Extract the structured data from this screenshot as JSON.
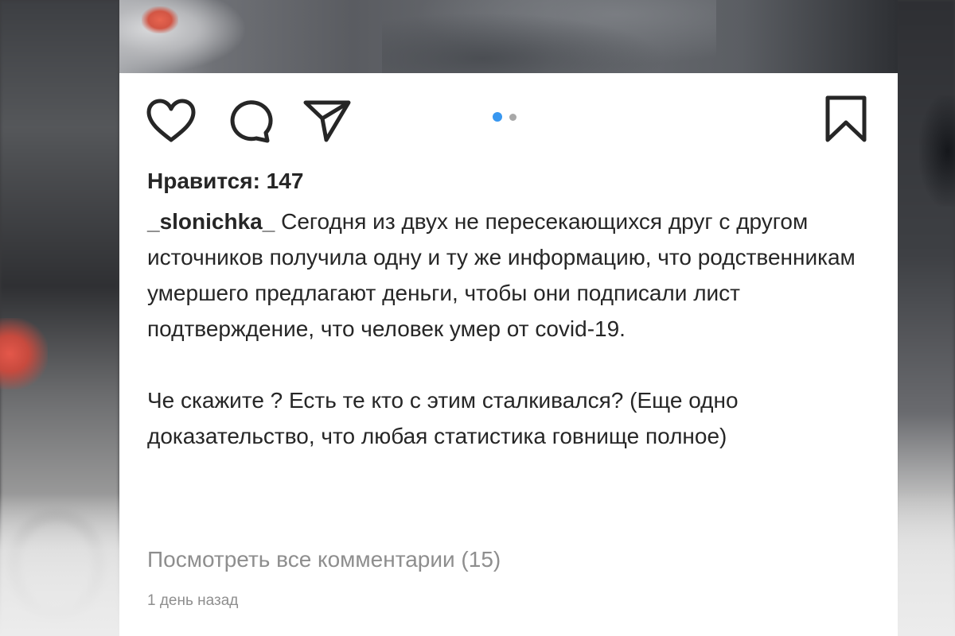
{
  "post": {
    "likes_text": "Нравится: 147",
    "author": "_slonichka_",
    "caption_paragraph_1": "Сегодня из двух не пересекающихся друг с другом источников получила одну и ту же информацию, что родственникам умершего предлагают деньги, чтобы они подписали лист подтверждение, что человек умер от covid-19.",
    "caption_paragraph_2": "Че скажите ? Есть те кто с этим сталкивался? (Еще одно доказательство, что любая статистика говнище полное)",
    "view_comments": "Посмотреть все комментарии (15)",
    "timestamp": "1 день назад"
  },
  "actions": {
    "icons": [
      "heart-icon",
      "comment-icon",
      "share-icon",
      "bookmark-icon"
    ]
  },
  "carousel": {
    "total": 2,
    "active_index": 1
  },
  "colors": {
    "text": "#262626",
    "muted": "#8e8e8e",
    "active_dot": "#3897f0",
    "inactive_dot": "#a8a8a8"
  }
}
